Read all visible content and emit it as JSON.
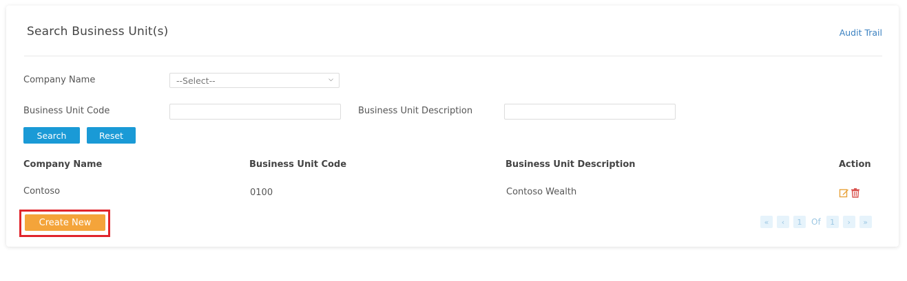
{
  "page": {
    "title": "Search Business Unit(s)",
    "audit_trail": "Audit Trail"
  },
  "form": {
    "company_name_label": "Company Name",
    "company_select_value": "--Select--",
    "bu_code_label": "Business Unit Code",
    "bu_code_value": "",
    "bu_desc_label": "Business Unit Description",
    "bu_desc_value": "",
    "search_label": "Search",
    "reset_label": "Reset"
  },
  "table": {
    "headers": [
      "Company Name",
      "Business Unit Code",
      "Business Unit Description",
      "Action"
    ],
    "rows": [
      {
        "company": "Contoso",
        "code": "0100",
        "description": "Contoso Wealth"
      }
    ],
    "action_icons": [
      "edit-icon",
      "delete-icon"
    ]
  },
  "footer": {
    "create_label": "Create New",
    "pager": {
      "first": "«",
      "prev": "‹",
      "current": "1",
      "of": "Of",
      "total": "1",
      "next": "›",
      "last": "»"
    }
  },
  "colors": {
    "accent_blue": "#1a9ad6",
    "create_orange": "#f4a43a",
    "highlight_red": "#e0242b",
    "edit_icon": "#e8a23a",
    "delete_icon": "#d9534f"
  }
}
